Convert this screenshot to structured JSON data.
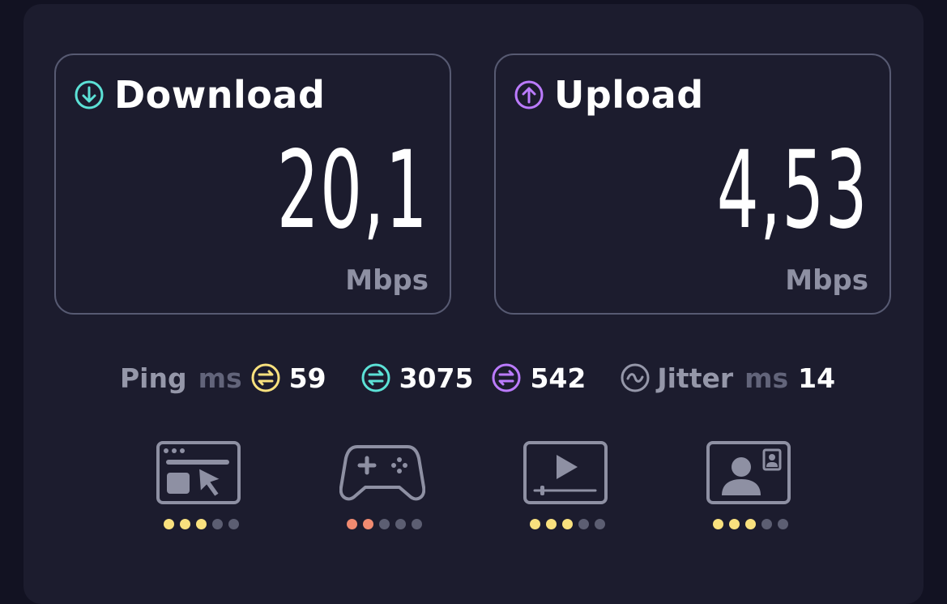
{
  "download": {
    "title": "Download",
    "value": "20,1",
    "unit": "Mbps",
    "icon": "arrow-down-circle-icon",
    "color": "#5ce1d6"
  },
  "upload": {
    "title": "Upload",
    "value": "4,53",
    "unit": "Mbps",
    "icon": "arrow-up-circle-icon",
    "color": "#bb7bff"
  },
  "ping": {
    "label": "Ping",
    "unit": "ms",
    "idle": "59",
    "download": "3075",
    "upload": "542",
    "colors": {
      "idle": "#f9e17e",
      "download": "#5ce1d6",
      "upload": "#bb7bff"
    }
  },
  "jitter": {
    "label": "Jitter",
    "unit": "ms",
    "value": "14"
  },
  "use_cases": [
    {
      "icon": "web-browsing-icon",
      "rating": 3,
      "max": 5,
      "color": "#f9e17e"
    },
    {
      "icon": "gaming-controller-icon",
      "rating": 2,
      "max": 5,
      "color": "#f08a70"
    },
    {
      "icon": "video-streaming-icon",
      "rating": 3,
      "max": 5,
      "color": "#f9e17e"
    },
    {
      "icon": "video-call-icon",
      "rating": 3,
      "max": 5,
      "color": "#f9e17e"
    }
  ]
}
